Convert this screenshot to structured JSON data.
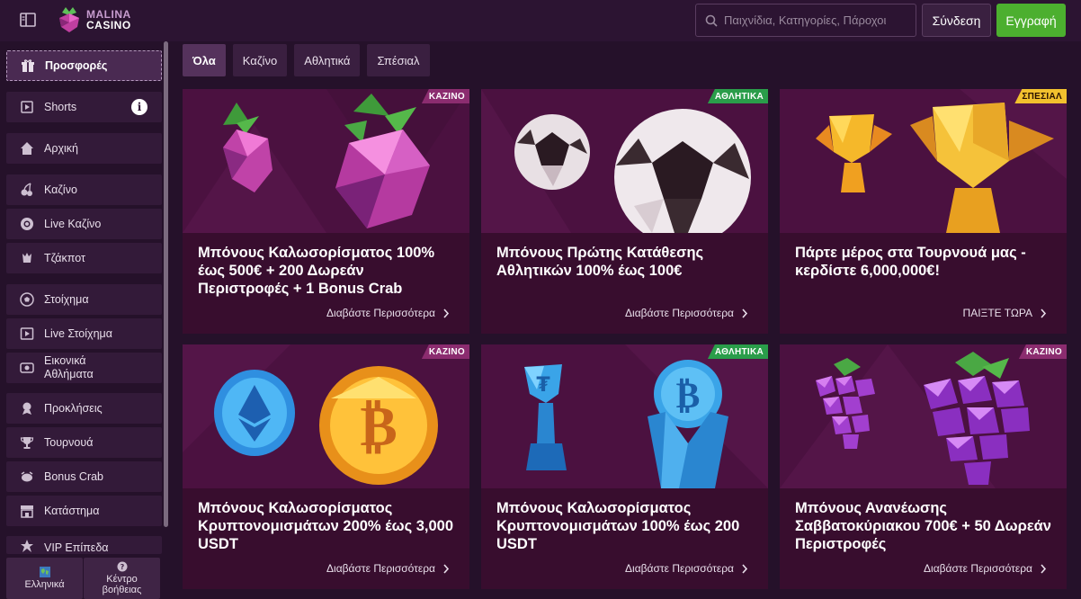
{
  "header": {
    "logo_top": "MALINA",
    "logo_bottom": "CASINO",
    "search_placeholder": "Παιχνίδια, Κατηγορίες, Πάροχοι",
    "login_label": "Σύνδεση",
    "register_label": "Εγγραφή",
    "register_color": "#4caf2f"
  },
  "sidebar": {
    "items": [
      {
        "label": "Προσφορές",
        "icon": "gift-icon"
      },
      {
        "label": "Shorts",
        "icon": "shorts-icon"
      },
      {
        "label": "Αρχική",
        "icon": "home-icon"
      },
      {
        "label": "Καζίνο",
        "icon": "cherries-icon"
      },
      {
        "label": "Live Καζίνο",
        "icon": "chip-icon"
      },
      {
        "label": "Τζάκποτ",
        "icon": "jackpot-icon"
      },
      {
        "label": "Στοίχημα",
        "icon": "soccer-ball-icon"
      },
      {
        "label": "Live Στοίχημα",
        "icon": "live-play-icon"
      },
      {
        "label": "Εικονικά Αθλήματα",
        "icon": "virtual-sports-icon"
      },
      {
        "label": "Προκλήσεις",
        "icon": "challenge-icon"
      },
      {
        "label": "Τουρνουά",
        "icon": "trophy-icon"
      },
      {
        "label": "Bonus Crab",
        "icon": "crab-icon"
      },
      {
        "label": "Κατάστημα",
        "icon": "store-icon"
      },
      {
        "label": "VIP Επίπεδα",
        "icon": "vip-icon"
      }
    ],
    "footer": {
      "language_label": "Ελληνικά",
      "help_label": "Κέντρο βοήθειας"
    }
  },
  "tabs": [
    {
      "label": "Όλα"
    },
    {
      "label": "Καζίνο"
    },
    {
      "label": "Αθλητικά"
    },
    {
      "label": "Σπέσιαλ"
    }
  ],
  "cards": [
    {
      "tag": "ΚΑΖΙΝΟ",
      "tag_type": "casino",
      "title": "Μπόνους Καλωσορίσματος 100% έως 500€ + 200 Δωρεάν Περιστροφές + 1 Bonus Crab",
      "link": "Διαβάστε Περισσότερα",
      "art": "raspberry-art"
    },
    {
      "tag": "ΑΘΛΗΤΙΚΑ",
      "tag_type": "sport",
      "title": "Μπόνους Πρώτης Κατάθεσης Αθλητικών 100% έως 100€",
      "link": "Διαβάστε Περισσότερα",
      "art": "soccer-ball-art"
    },
    {
      "tag": "ΣΠΕΣΙΑΛ",
      "tag_type": "special",
      "title": "Πάρτε μέρος στα Τουρνουά μας - κερδίστε 6,000,000€!",
      "link": "ΠΑΙΞΤΕ ΤΩΡΑ",
      "art": "trophy-art"
    },
    {
      "tag": "ΚΑΖΙΝΟ",
      "tag_type": "casino",
      "title": "Μπόνους Καλωσορίσματος Κρυπτονομισμάτων 200% έως 3,000 USDT",
      "link": "Διαβάστε Περισσότερα",
      "art": "crypto-coins-art"
    },
    {
      "tag": "ΑΘΛΗΤΙΚΑ",
      "tag_type": "sport",
      "title": "Μπόνους Καλωσορίσματος Κρυπτονομισμάτων 100% έως 200 USDT",
      "link": "Διαβάστε Περισσότερα",
      "art": "crypto-trophy-art"
    },
    {
      "tag": "ΚΑΖΙΝΟ",
      "tag_type": "casino",
      "title": "Μπόνους Ανανέωσης Σαββατοκύριακου 700€ + 50 Δωρεάν Περιστροφές",
      "link": "Διαβάστε Περισσότερα",
      "art": "grapes-art"
    }
  ]
}
